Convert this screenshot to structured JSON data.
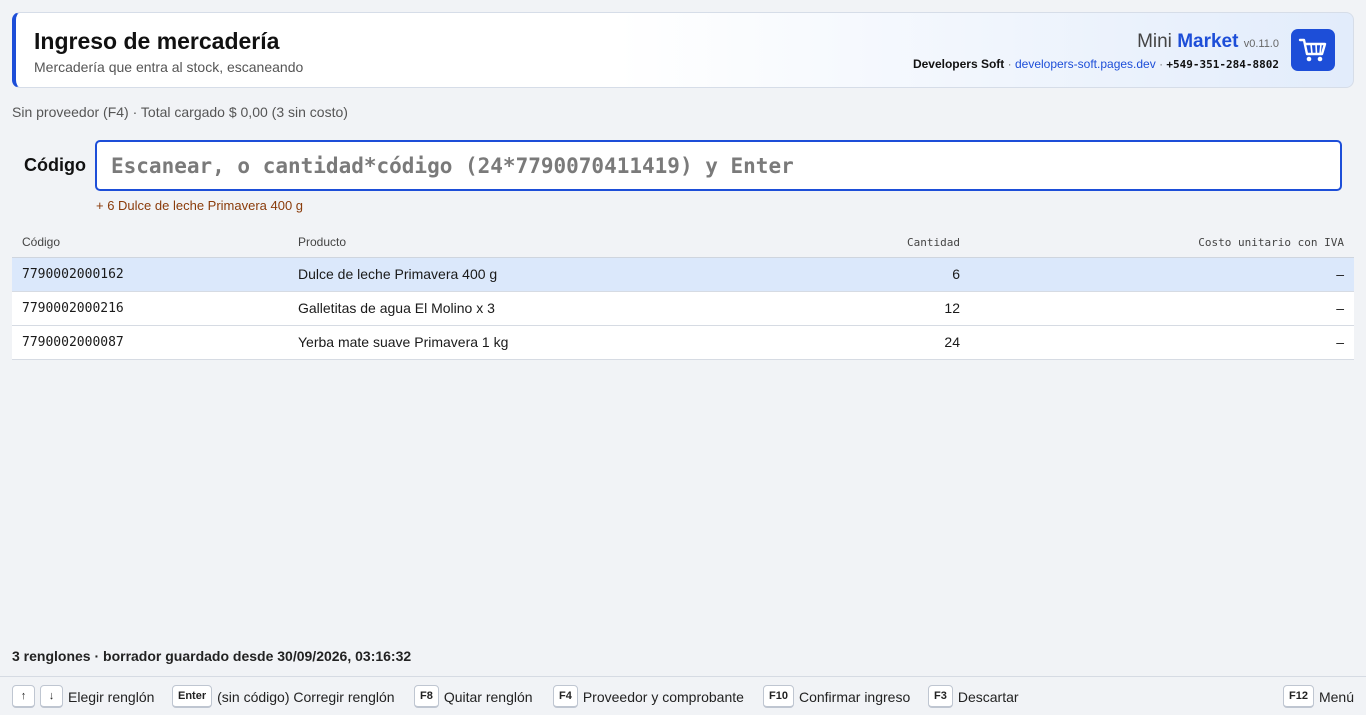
{
  "header": {
    "title": "Ingreso de mercadería",
    "subtitle": "Mercadería que entra al stock, escaneando",
    "brand_light": "Mini ",
    "brand_bold": "Market",
    "version": "v0.11.0",
    "company": "Developers Soft",
    "site": "developers-soft.pages.dev",
    "phone": "+549-351-284-8802",
    "separator": " · "
  },
  "summary": "Sin proveedor (F4) · Total cargado $ 0,00 (3 sin costo)",
  "scan": {
    "label": "Código",
    "placeholder": "Escanear, o cantidad*código (24*7790070411419) y Enter",
    "value": "",
    "last_added": "+ 6 Dulce de leche Primavera 400 g"
  },
  "table": {
    "columns": [
      "Código",
      "Producto",
      "Cantidad",
      "Costo unitario con IVA"
    ],
    "rows": [
      {
        "code": "7790002000162",
        "product": "Dulce de leche Primavera 400 g",
        "qty": "6",
        "cost": "–"
      },
      {
        "code": "7790002000216",
        "product": "Galletitas de agua El Molino x 3",
        "qty": "12",
        "cost": "–"
      },
      {
        "code": "7790002000087",
        "product": "Yerba mate suave Primavera 1 kg",
        "qty": "24",
        "cost": "–"
      }
    ]
  },
  "status": "3 renglones · borrador guardado desde 30/09/2026, 03:16:32",
  "hotkeys": [
    {
      "keys": [
        "↑",
        "↓"
      ],
      "label": "Elegir renglón"
    },
    {
      "keys": [
        "Enter"
      ],
      "label": "(sin código) Corregir renglón"
    },
    {
      "keys": [
        "F8"
      ],
      "label": "Quitar renglón"
    },
    {
      "keys": [
        "F4"
      ],
      "label": "Proveedor y comprobante"
    },
    {
      "keys": [
        "F10"
      ],
      "label": "Confirmar ingreso"
    },
    {
      "keys": [
        "F3"
      ],
      "label": "Descartar"
    },
    {
      "keys": [
        "F12"
      ],
      "label": "Menú"
    }
  ],
  "colors": {
    "accent": "#1d4ed8",
    "last_added": "#8a3b0a",
    "selected_row": "#dbe8fb"
  },
  "icons": {
    "brand": "shopping-cart-icon"
  }
}
